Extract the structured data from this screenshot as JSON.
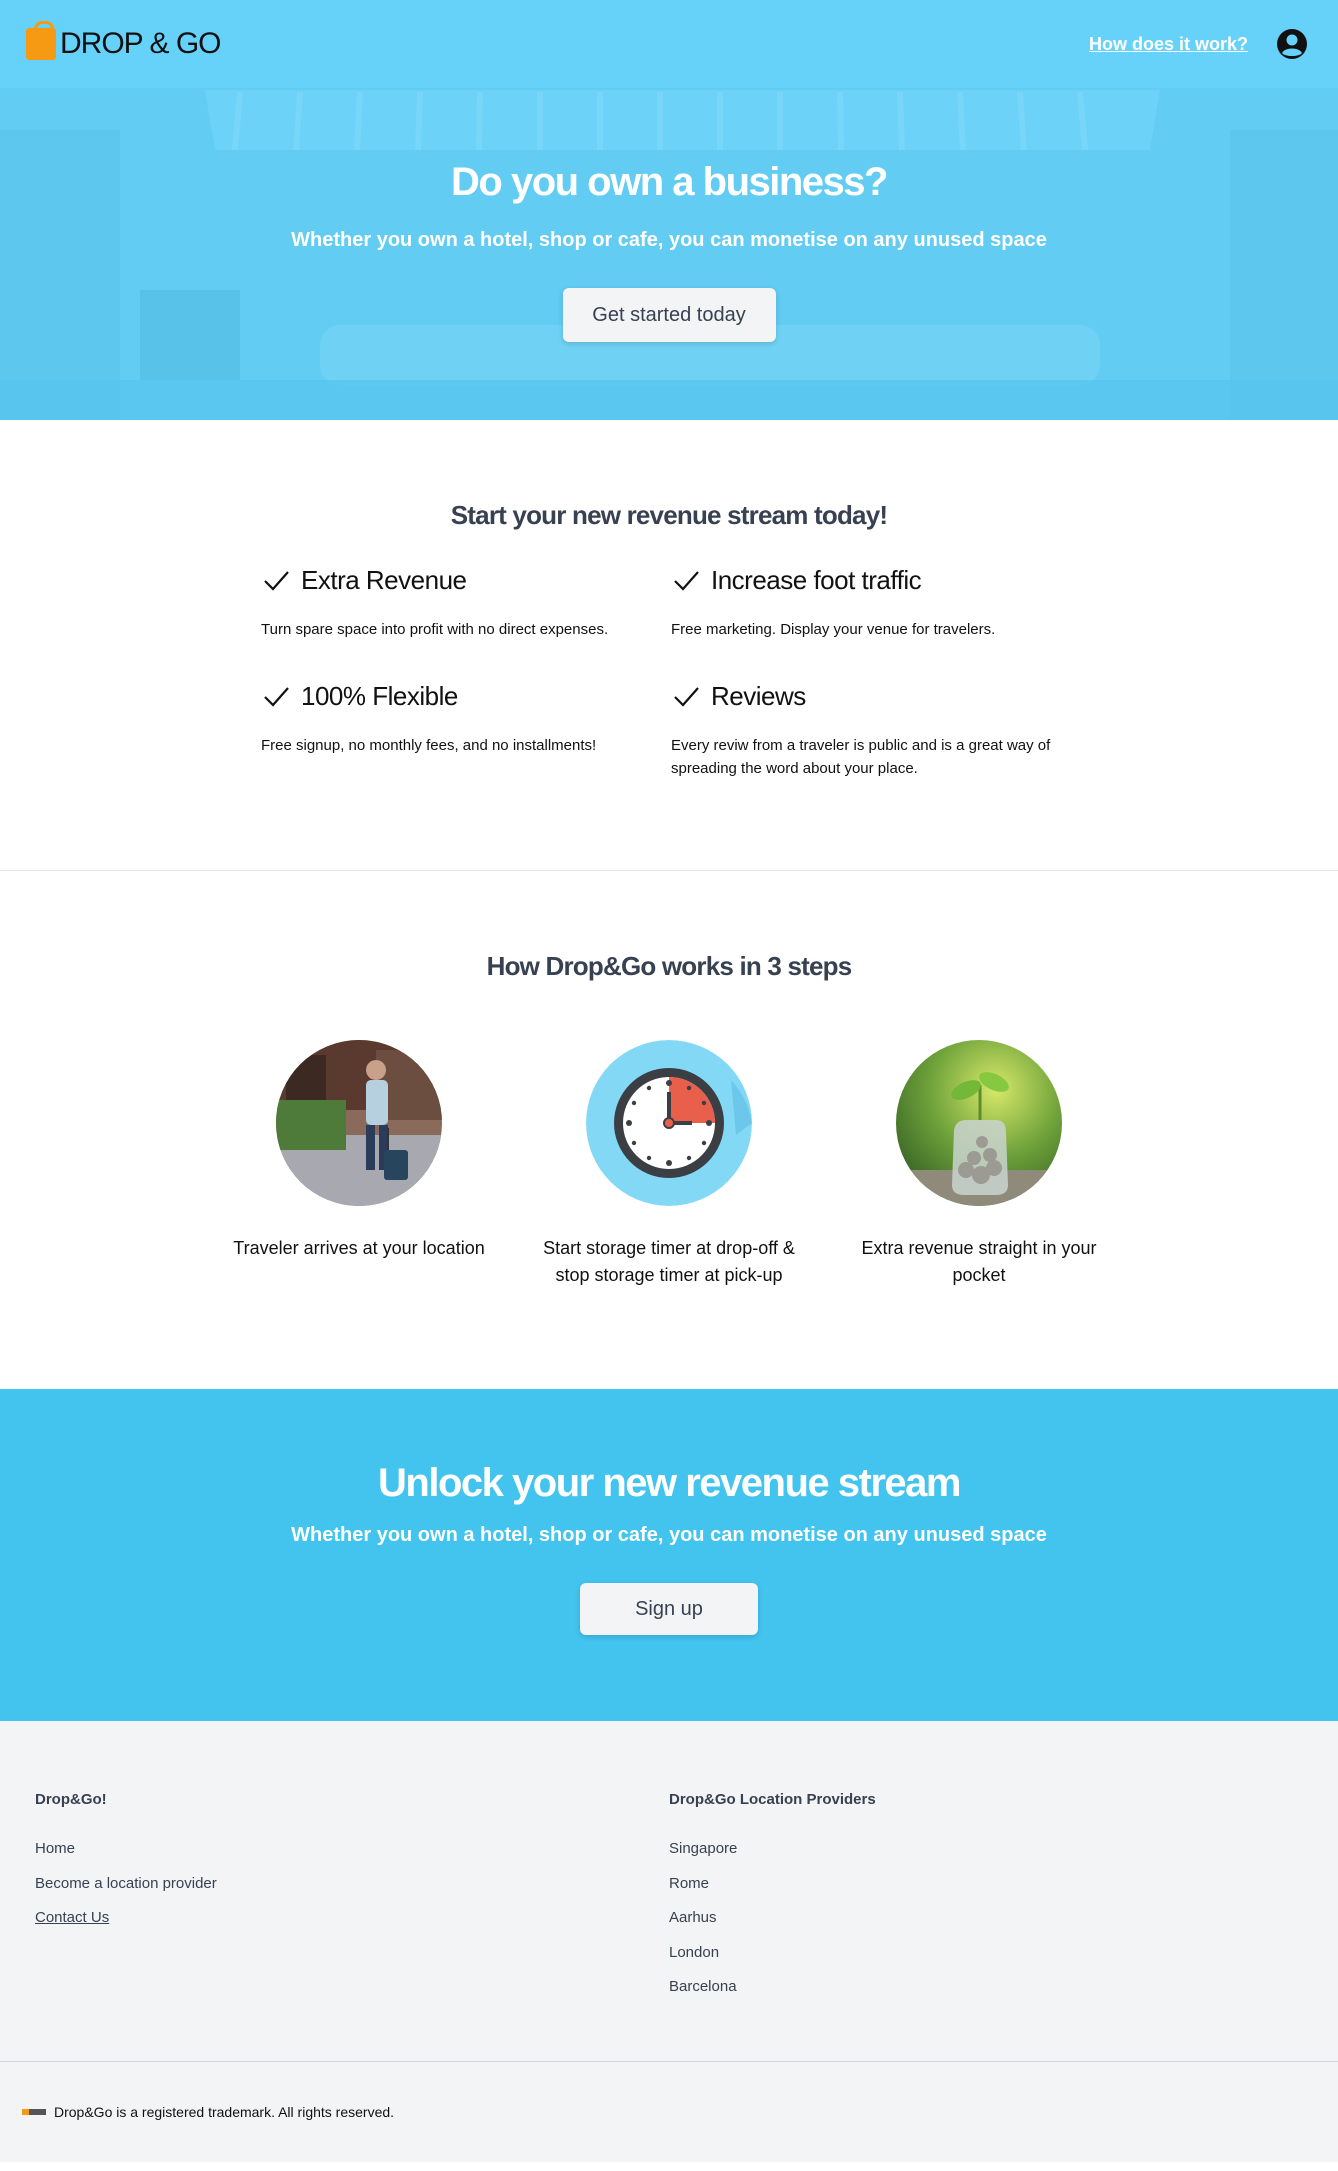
{
  "header": {
    "logo_text": "DROP & GO",
    "nav_link": "How does it work?"
  },
  "hero": {
    "title": "Do you own a business?",
    "subtitle": "Whether you own a hotel, shop or cafe, you can monetise on any unused space",
    "button": "Get started today"
  },
  "features": {
    "title": "Start your new revenue stream today!",
    "items": [
      {
        "title": "Extra Revenue",
        "desc": "Turn spare space into profit with no direct expenses."
      },
      {
        "title": "Increase foot traffic",
        "desc": "Free marketing. Display your venue for travelers."
      },
      {
        "title": "100% Flexible",
        "desc": "Free signup, no monthly fees, and no installments!"
      },
      {
        "title": "Reviews",
        "desc": "Every reviw from a traveler is public and is a great way of spreading the word about your place."
      }
    ]
  },
  "steps": {
    "title": "How Drop&Go works in 3 steps",
    "items": [
      {
        "text": "Traveler arrives at your location",
        "icon": "traveler-photo"
      },
      {
        "text": "Start storage timer at drop-off & stop storage timer at pick-up",
        "icon": "clock-icon"
      },
      {
        "text": "Extra revenue straight in your pocket",
        "icon": "coin-jar-photo"
      }
    ]
  },
  "cta": {
    "title": "Unlock your new revenue stream",
    "subtitle": "Whether you own a hotel, shop or cafe, you can monetise on any unused space",
    "button": "Sign up"
  },
  "footer": {
    "col1": {
      "title": "Drop&Go!",
      "links": [
        "Home",
        "Become a location provider",
        "Contact Us"
      ]
    },
    "col2": {
      "title": "Drop&Go Location Providers",
      "links": [
        "Singapore",
        "Rome",
        "Aarhus",
        "London",
        "Barcelona"
      ]
    },
    "copyright": "Drop&Go is a registered trademark. All rights reserved."
  },
  "colors": {
    "brand_blue": "#42c4ef",
    "logo_orange": "#f59a12",
    "heading_gray": "#374151"
  }
}
